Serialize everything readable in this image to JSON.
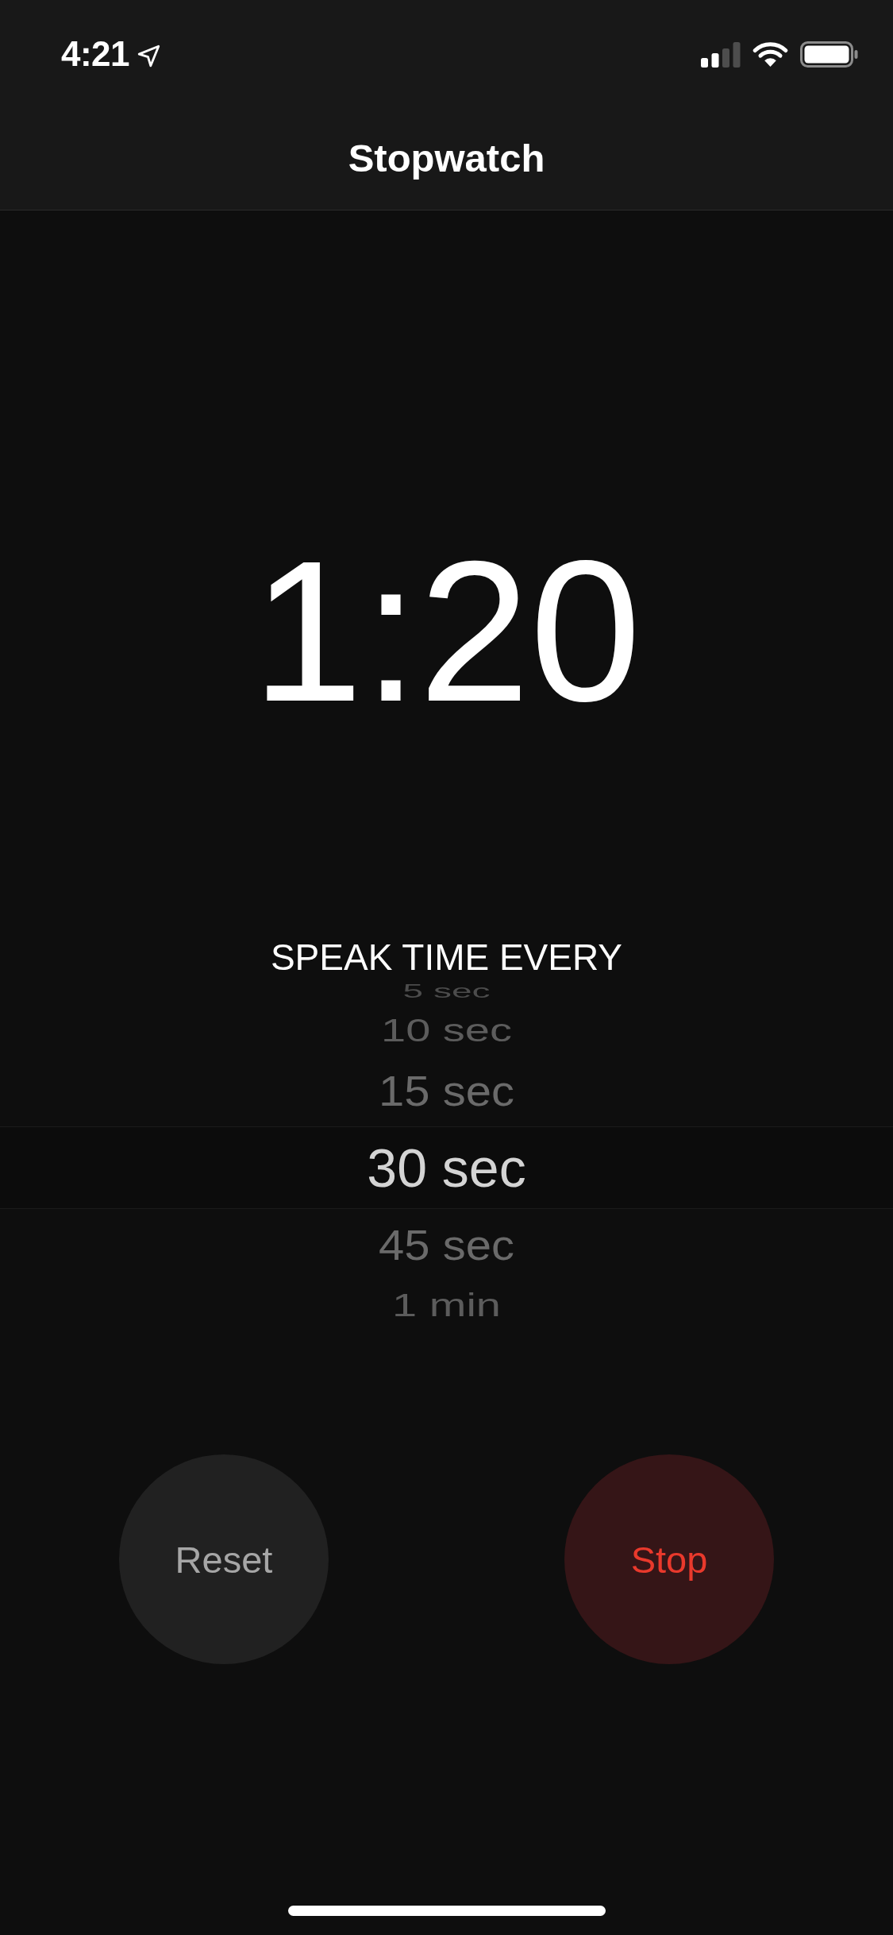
{
  "status_bar": {
    "time": "4:21"
  },
  "nav_bar": {
    "title": "Stopwatch"
  },
  "elapsed_time": "1:20",
  "speak_time_picker": {
    "label": "SPEAK TIME EVERY",
    "options": [
      {
        "label": "5 sec",
        "selected": false
      },
      {
        "label": "10 sec",
        "selected": false
      },
      {
        "label": "15 sec",
        "selected": false
      },
      {
        "label": "30 sec",
        "selected": true
      },
      {
        "label": "45 sec",
        "selected": false
      },
      {
        "label": "1 min",
        "selected": false
      }
    ]
  },
  "buttons": [
    {
      "label": "Reset",
      "kind": "neutral"
    },
    {
      "label": "Stop",
      "kind": "destructive"
    }
  ]
}
